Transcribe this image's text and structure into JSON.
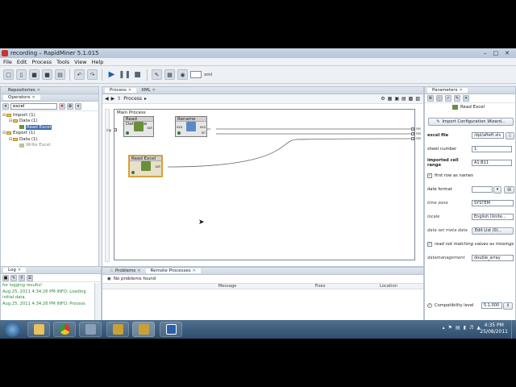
{
  "window": {
    "title": "recording – RapidMiner 5.1.015"
  },
  "menu": [
    "File",
    "Edit",
    "Process",
    "Tools",
    "View",
    "Help"
  ],
  "toolbar": {
    "xml_label": "xml"
  },
  "left_tabs": {
    "repositories": "Repositories",
    "operators": "Operators"
  },
  "operators_search": {
    "value": "excel"
  },
  "tree": [
    {
      "label": "Import (1)",
      "level": 0,
      "kind": "folder"
    },
    {
      "label": "Data (1)",
      "level": 1,
      "kind": "folder"
    },
    {
      "label": "Read Excel",
      "level": 2,
      "kind": "op",
      "selected": true
    },
    {
      "label": "Export (1)",
      "level": 0,
      "kind": "folder"
    },
    {
      "label": "Data (1)",
      "level": 1,
      "kind": "folder"
    },
    {
      "label": "Write Excel",
      "level": 2,
      "kind": "op",
      "disabled": true
    }
  ],
  "log": {
    "tab": "Log",
    "lines": [
      "for logging results!",
      "Aug 25, 2011 4:34:26 PM INFO: Loading",
      "initial data.",
      "Aug 25, 2011 4:34:26 PM INFO: Process"
    ]
  },
  "process_tabs": {
    "process": "Process",
    "xml": "XML"
  },
  "process": {
    "breadcrumb": "Process",
    "canvas_title": "Main Process",
    "operators": {
      "read_database": {
        "name": "Read Database",
        "port_out": "out"
      },
      "rename": {
        "name": "Rename",
        "port_in": "exa",
        "port_out1": "exa",
        "port_out2": "ori"
      },
      "read_excel": {
        "name": "Read Excel",
        "port_out": "out"
      }
    },
    "left_port": "inp",
    "right_ports": [
      "res",
      "res",
      "res"
    ]
  },
  "problems": {
    "tab_problems": "Problems",
    "tab_remote": "Remote Processes",
    "message": "No problems found",
    "columns": [
      "Message",
      "Fixes",
      "Location"
    ]
  },
  "params": {
    "tab": "Parameters",
    "operator": "Read Excel",
    "wizard_label": "Import Configuration Wizard...",
    "rows": {
      "excel_file": {
        "label": "excel file",
        "value": "/dpl/afteft.xls"
      },
      "sheet_number": {
        "label": "sheet number",
        "value": "1"
      },
      "cell_range": {
        "label": "imported cell range",
        "value": "A1:B11"
      },
      "first_row": {
        "label": "first row as names"
      },
      "date_format": {
        "label": "date format"
      },
      "time_zone": {
        "label": "time zone",
        "value": "SYSTEM"
      },
      "locale": {
        "label": "locale",
        "value": "English (Unite..."
      },
      "meta_data": {
        "label": "data set meta data",
        "button": "Edit List (0)..."
      },
      "read_not_matching": {
        "label": "read not matching values as missings"
      },
      "datamanagement": {
        "label": "datamanagement",
        "value": "double_array"
      }
    },
    "compat_label": "Compatibility level",
    "compat_value": "5.1.000"
  },
  "taskbar": {
    "time": "4:35 PM",
    "date": "25/08/2011"
  }
}
